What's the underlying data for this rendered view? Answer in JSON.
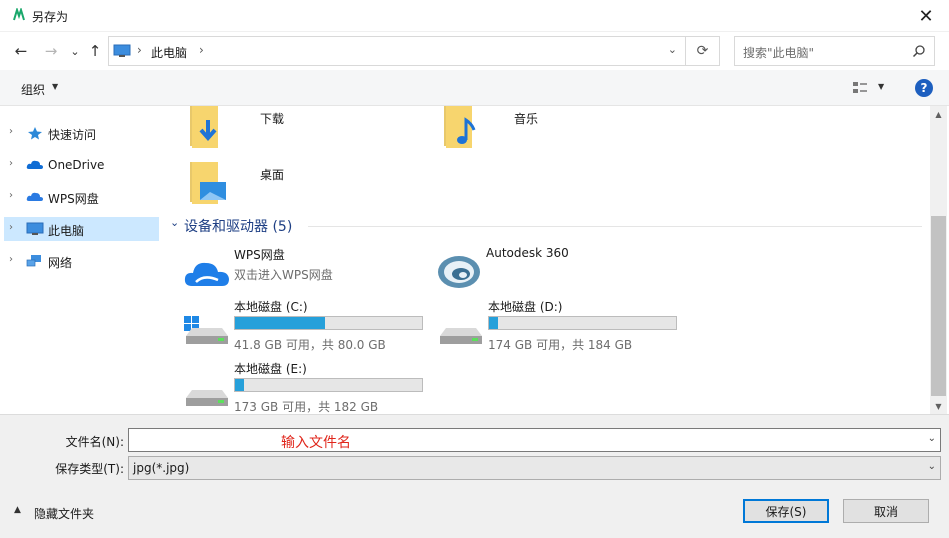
{
  "window": {
    "title": "另存为",
    "close": "✕"
  },
  "nav": {
    "back": "←",
    "forward": "→",
    "recent": "⌄",
    "up": "↑"
  },
  "address": {
    "chevron": "›",
    "location": "此电脑",
    "dropdown": "⌄",
    "refresh": "⟳"
  },
  "search": {
    "placeholder": "搜索\"此电脑\""
  },
  "toolbar": {
    "organize": "组织",
    "dropdown": "▼",
    "help": "?"
  },
  "sidebar": {
    "items": [
      {
        "label": "快速访问",
        "icon": "star-pin-icon",
        "chevron": "›"
      },
      {
        "label": "OneDrive",
        "icon": "cloud-icon",
        "chevron": "›"
      },
      {
        "label": "WPS网盘",
        "icon": "wps-cloud-icon",
        "chevron": "›"
      },
      {
        "label": "此电脑",
        "icon": "computer-icon",
        "chevron": "›",
        "selected": true
      },
      {
        "label": "网络",
        "icon": "network-icon",
        "chevron": "›"
      }
    ]
  },
  "folders": [
    {
      "label": "下载",
      "icon": "download-folder-icon"
    },
    {
      "label": "音乐",
      "icon": "music-folder-icon"
    },
    {
      "label": "桌面",
      "icon": "desktop-folder-icon"
    }
  ],
  "devices": {
    "header": "设备和驱动器 (5)",
    "chevron": "⌄",
    "wps": {
      "name": "WPS网盘",
      "sub": "双击进入WPS网盘"
    },
    "autodesk": {
      "name": "Autodesk 360"
    },
    "drives": [
      {
        "name": "本地磁盘 (C:)",
        "free_text": "41.8 GB 可用，共 80.0 GB",
        "used_fraction": 0.48
      },
      {
        "name": "本地磁盘 (D:)",
        "free_text": "174 GB 可用，共 184 GB",
        "used_fraction": 0.05
      },
      {
        "name": "本地磁盘 (E:)",
        "free_text": "173 GB 可用，共 182 GB",
        "used_fraction": 0.05
      }
    ]
  },
  "scrollbar": {
    "up": "▲",
    "down": "▼"
  },
  "form": {
    "filename_label": "文件名(N):",
    "filename_value": "",
    "filename_hint": "输入文件名",
    "dropdown": "⌄",
    "filetype_label": "保存类型(T):",
    "filetype_value": "jpg(*.jpg)"
  },
  "footer": {
    "hide_arrow": "▲",
    "hide_folders": "隐藏文件夹",
    "save": "保存(S)",
    "cancel": "取消"
  },
  "colors": {
    "accent": "#0078d7",
    "selected": "#cce8ff",
    "drive_fill": "#26a0da",
    "hint": "#e0261b"
  }
}
